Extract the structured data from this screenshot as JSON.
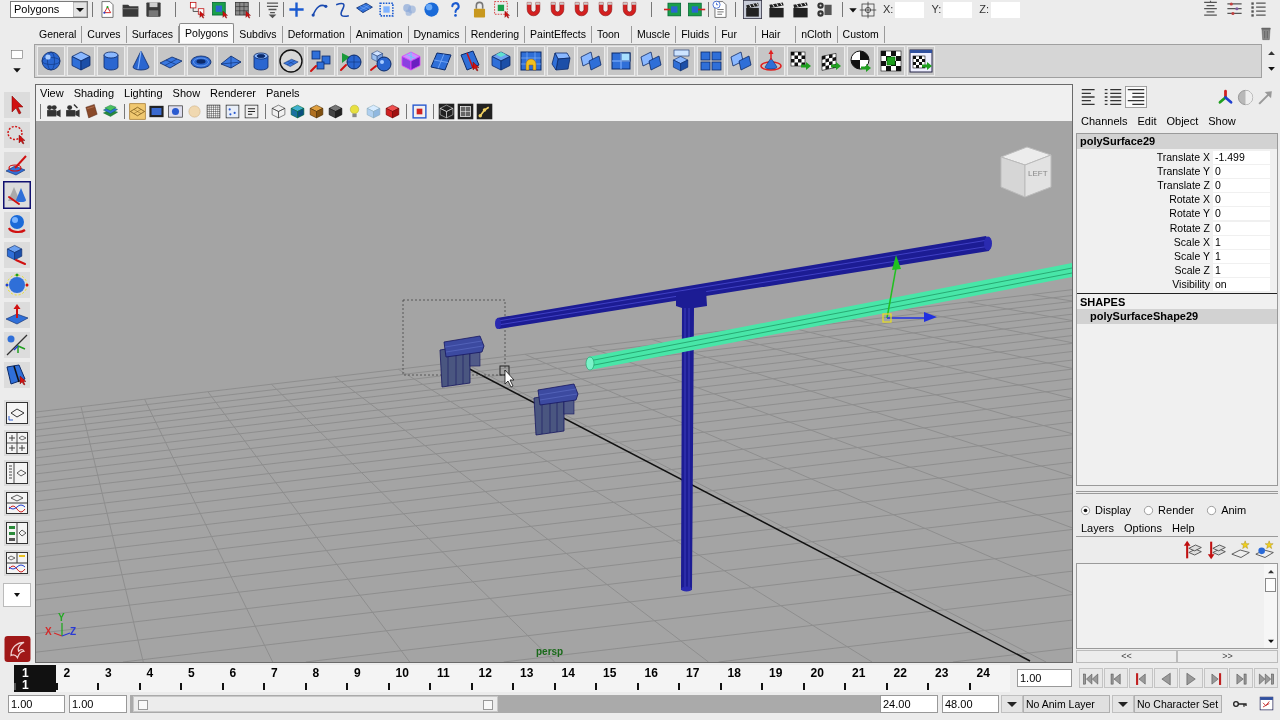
{
  "status_line": {
    "menu_set": "Polygons",
    "coordinates": [
      {
        "label": "X:"
      },
      {
        "label": "Y:"
      },
      {
        "label": "Z:"
      }
    ]
  },
  "shelf": {
    "tabs": [
      {
        "label": "General",
        "selected": false
      },
      {
        "label": "Curves",
        "selected": false
      },
      {
        "label": "Surfaces",
        "selected": false
      },
      {
        "label": "Polygons",
        "selected": true
      },
      {
        "label": "Subdivs",
        "selected": false
      },
      {
        "label": "Deformation",
        "selected": false
      },
      {
        "label": "Animation",
        "selected": false
      },
      {
        "label": "Dynamics",
        "selected": false
      },
      {
        "label": "Rendering",
        "selected": false
      },
      {
        "label": "PaintEffects",
        "selected": false
      },
      {
        "label": "Toon",
        "selected": false
      },
      {
        "label": "Muscle",
        "selected": false
      },
      {
        "label": "Fluids",
        "selected": false
      },
      {
        "label": "Fur",
        "selected": false
      },
      {
        "label": "Hair",
        "selected": false
      },
      {
        "label": "nCloth",
        "selected": false
      },
      {
        "label": "Custom",
        "selected": false
      }
    ]
  },
  "toolbox": {
    "tools": [
      {
        "selected": false
      },
      {
        "selected": false
      },
      {
        "selected": false
      },
      {
        "selected": true
      },
      {
        "selected": false
      },
      {
        "selected": false
      },
      {
        "selected": false
      },
      {
        "selected": false
      },
      {
        "selected": false
      },
      {
        "selected": false
      }
    ]
  },
  "viewport": {
    "menus": [
      "View",
      "Shading",
      "Lighting",
      "Show",
      "Renderer",
      "Panels"
    ],
    "view_cube_face": "LEFT",
    "axes": [
      {
        "label": "X",
        "color": "#d42a2a"
      },
      {
        "label": "Y",
        "color": "#22a822"
      },
      {
        "label": "Z",
        "color": "#2a3ad4"
      }
    ],
    "camera": "persp"
  },
  "channel_box": {
    "view_modes": [
      {
        "selected": false
      },
      {
        "selected": false
      },
      {
        "selected": true
      }
    ],
    "menus": [
      "Channels",
      "Edit",
      "Object",
      "Show"
    ],
    "object": "polySurface29",
    "attributes": [
      {
        "name": "Translate X",
        "value": "-1.499"
      },
      {
        "name": "Translate Y",
        "value": "0"
      },
      {
        "name": "Translate Z",
        "value": "0"
      },
      {
        "name": "Rotate X",
        "value": "0"
      },
      {
        "name": "Rotate Y",
        "value": "0"
      },
      {
        "name": "Rotate Z",
        "value": "0"
      },
      {
        "name": "Scale X",
        "value": "1"
      },
      {
        "name": "Scale Y",
        "value": "1"
      },
      {
        "name": "Scale Z",
        "value": "1"
      },
      {
        "name": "Visibility",
        "value": "on"
      }
    ],
    "shapes_heading": "SHAPES",
    "shapes": [
      "polySurfaceShape29"
    ]
  },
  "layer_editor": {
    "modes": [
      {
        "label": "Display",
        "selected": true
      },
      {
        "label": "Render",
        "selected": false
      },
      {
        "label": "Anim",
        "selected": false
      }
    ],
    "menus": [
      "Layers",
      "Options",
      "Help"
    ],
    "page_buttons": [
      "<<",
      ">>"
    ]
  },
  "time_slider": {
    "frames": [
      {
        "label": "1",
        "selected": true
      },
      {
        "label": "2",
        "selected": false
      },
      {
        "label": "3",
        "selected": false
      },
      {
        "label": "4",
        "selected": false
      },
      {
        "label": "5",
        "selected": false
      },
      {
        "label": "6",
        "selected": false
      },
      {
        "label": "7",
        "selected": false
      },
      {
        "label": "8",
        "selected": false
      },
      {
        "label": "9",
        "selected": false
      },
      {
        "label": "10",
        "selected": false
      },
      {
        "label": "11",
        "selected": false
      },
      {
        "label": "12",
        "selected": false
      },
      {
        "label": "13",
        "selected": false
      },
      {
        "label": "14",
        "selected": false
      },
      {
        "label": "15",
        "selected": false
      },
      {
        "label": "16",
        "selected": false
      },
      {
        "label": "17",
        "selected": false
      },
      {
        "label": "18",
        "selected": false
      },
      {
        "label": "19",
        "selected": false
      },
      {
        "label": "20",
        "selected": false
      },
      {
        "label": "21",
        "selected": false
      },
      {
        "label": "22",
        "selected": false
      },
      {
        "label": "23",
        "selected": false
      },
      {
        "label": "24",
        "selected": false
      }
    ],
    "current_frame": "1",
    "current_time": "1.00"
  },
  "range_slider": {
    "start_time": "1.00",
    "playback_start": "1.00",
    "level": 0.49,
    "playback_end": "24.00",
    "end_time": "48.00",
    "anim_layer": "No Anim Layer",
    "character_set": "No Character Set"
  }
}
